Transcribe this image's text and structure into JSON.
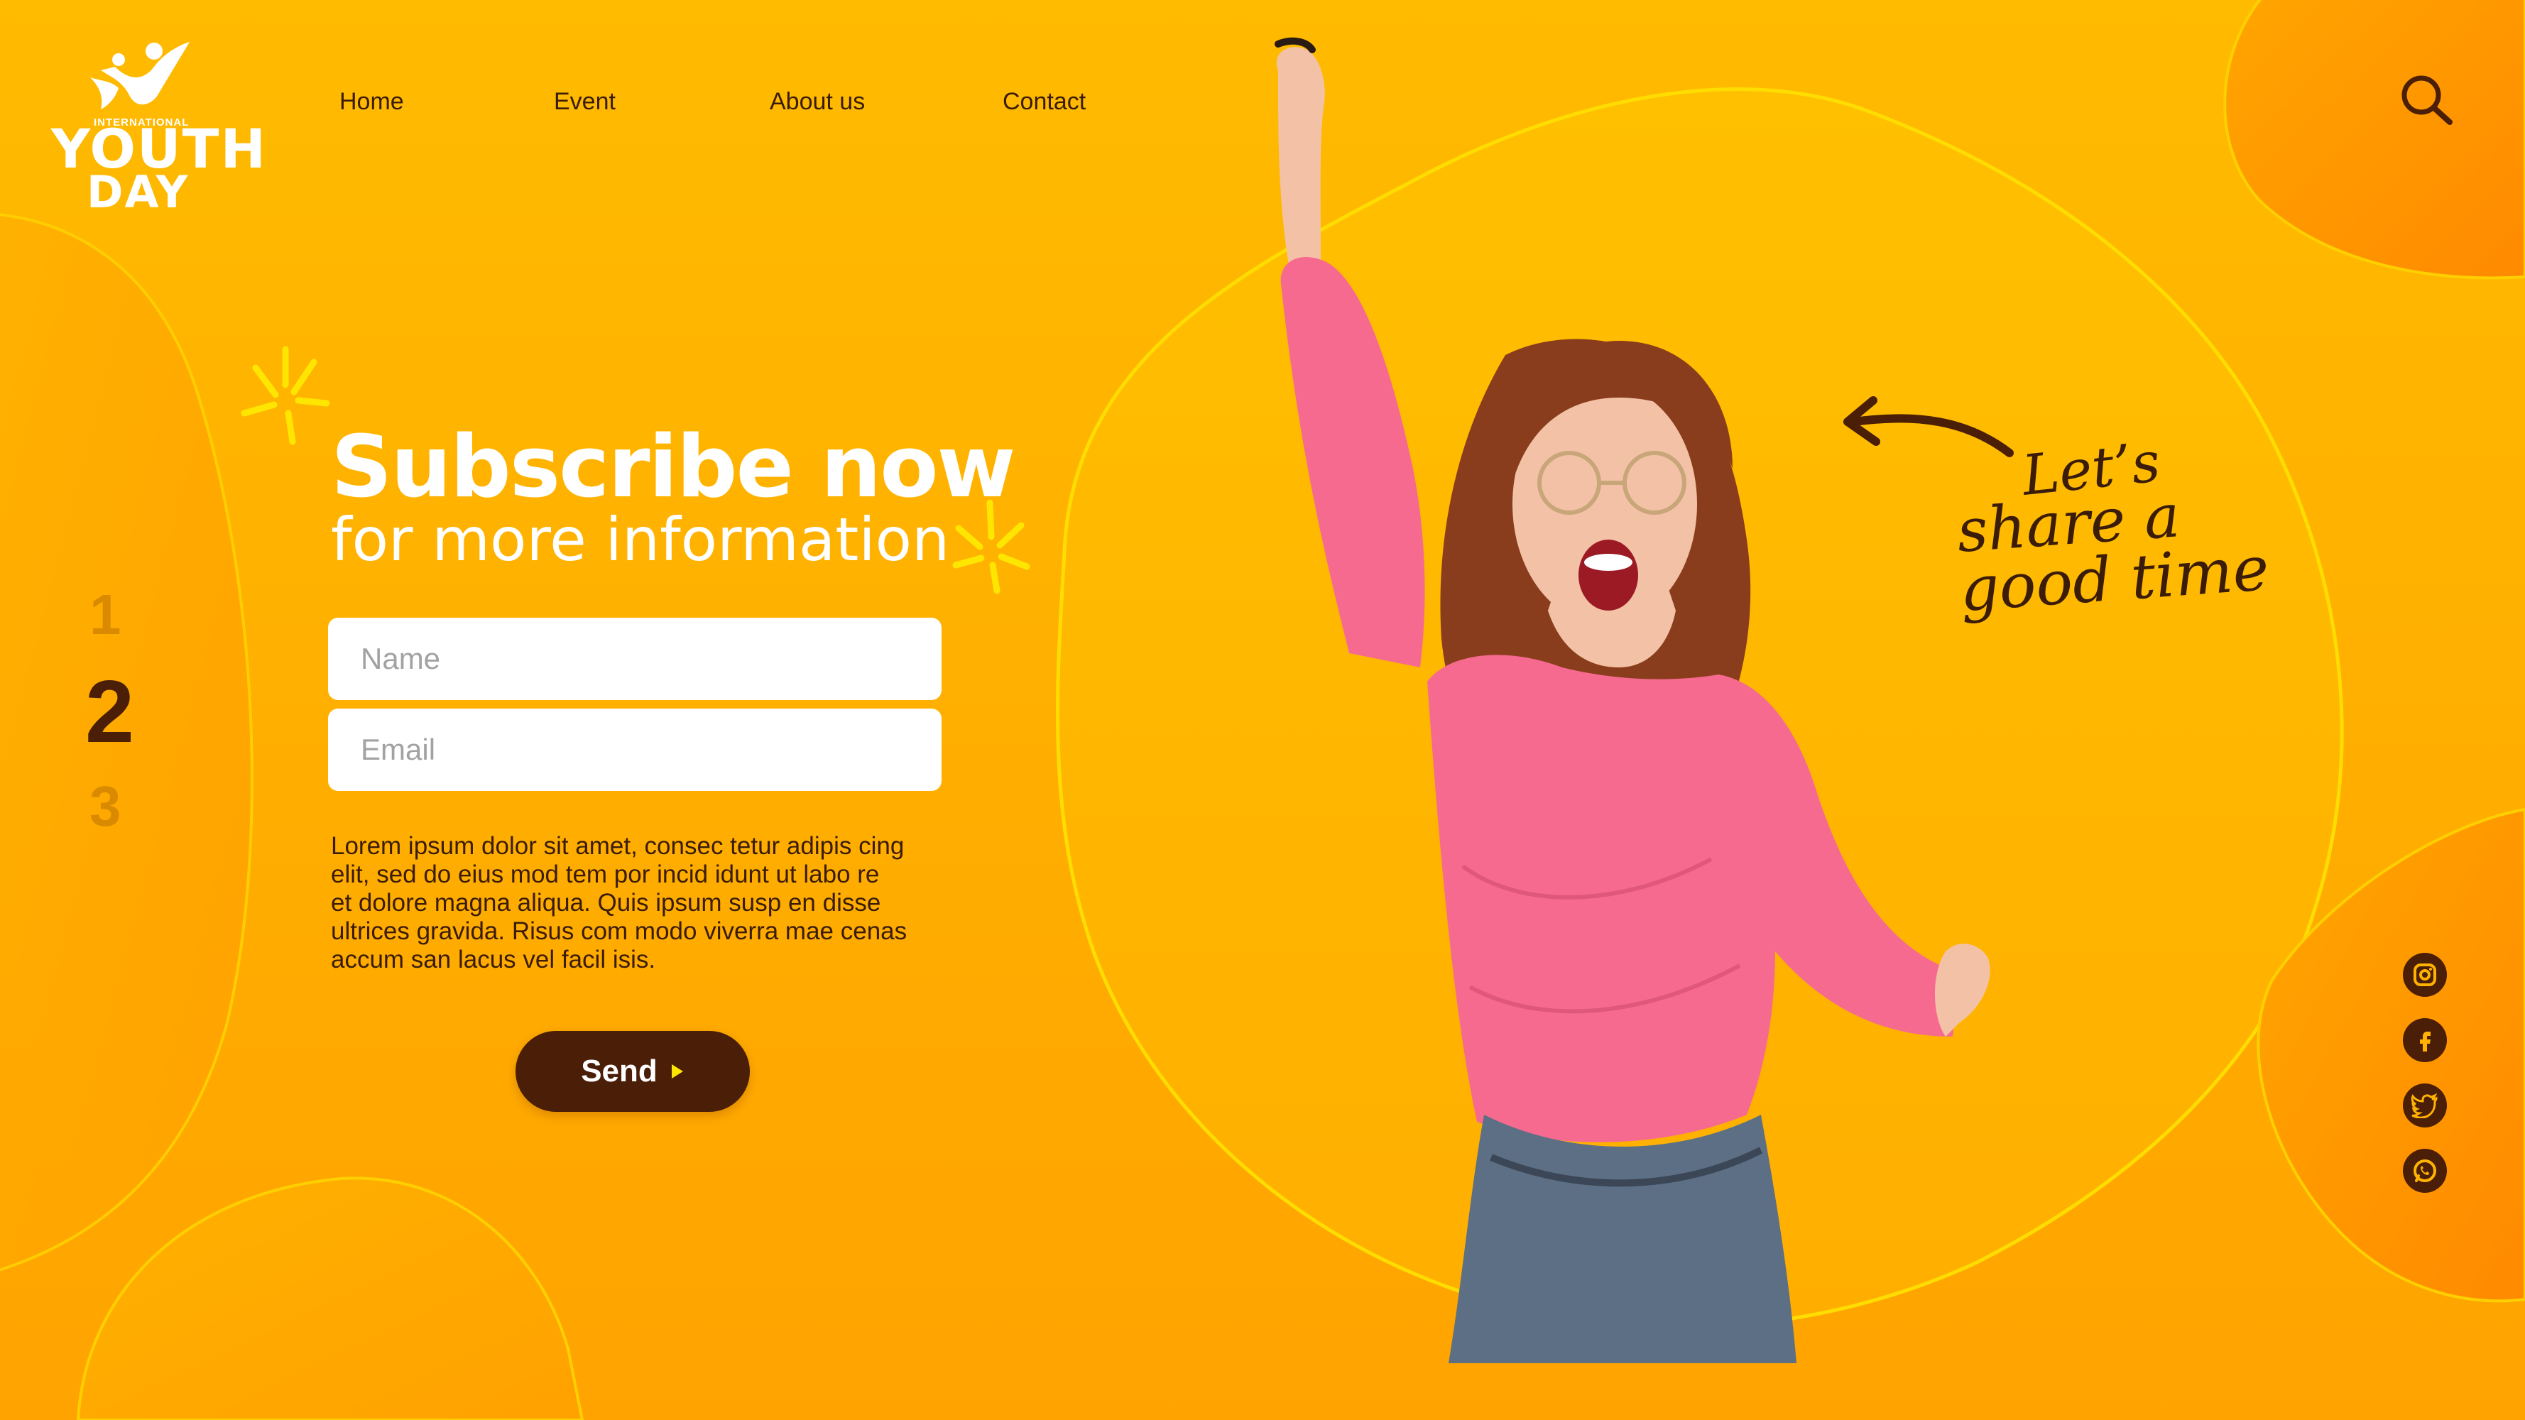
{
  "logo": {
    "top_text": "INTERNATIONAL",
    "line1": "YOUTH",
    "line2": "DAY"
  },
  "nav": {
    "home": "Home",
    "event": "Event",
    "about": "About us",
    "contact": "Contact"
  },
  "pager": [
    "1",
    "2",
    "3"
  ],
  "hero": {
    "title": "Subscribe now",
    "subtitle": "for more information"
  },
  "form": {
    "name_placeholder": "Name",
    "email_placeholder": "Email",
    "body_lines": [
      "Lorem ipsum dolor sit amet, consec tetur adipis cing",
      "elit, sed do eius mod tem por incid idunt ut labo re",
      "et dolore magna aliqua. Quis ipsum susp en disse",
      "ultrices gravida. Risus com modo viverra mae cenas",
      "accum san lacus vel facil isis."
    ],
    "send_label": "Send"
  },
  "tagline": {
    "line1": "Let’s",
    "line2": "share a",
    "line3": "good time"
  },
  "social": [
    "instagram-icon",
    "facebook-icon",
    "twitter-icon",
    "whatsapp-icon"
  ],
  "colors": {
    "background": "#ffb300",
    "dark_brown": "#4a1e07",
    "white": "#ffffff",
    "accent_yellow": "#ffe600",
    "shirt_pink": "#f76a90"
  }
}
